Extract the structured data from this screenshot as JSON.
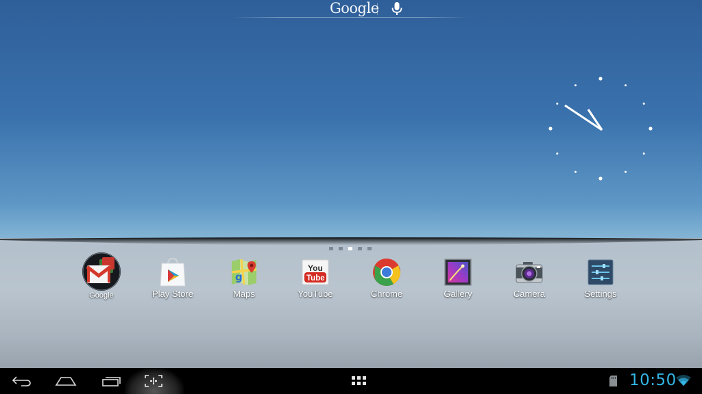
{
  "search_bar": {
    "logo_text": "Google",
    "voice_icon": "mic-icon"
  },
  "clock_widget": {
    "type": "analog",
    "hour_icon": "clock-hands-icon"
  },
  "home_pages": {
    "count": 5,
    "active_index": 2
  },
  "dock": {
    "apps": [
      {
        "label": "Google",
        "icon": "google-folder-icon"
      },
      {
        "label": "Play Store",
        "icon": "play-store-icon"
      },
      {
        "label": "Maps",
        "icon": "maps-icon"
      },
      {
        "label": "YouTube",
        "icon": "youtube-icon"
      },
      {
        "label": "Chrome",
        "icon": "chrome-icon"
      },
      {
        "label": "Gallery",
        "icon": "gallery-icon"
      },
      {
        "label": "Camera",
        "icon": "camera-icon"
      },
      {
        "label": "Settings",
        "icon": "settings-icon"
      }
    ]
  },
  "nav_bar": {
    "buttons": [
      "back-icon",
      "home-icon",
      "recent-apps-icon",
      "screenshot-icon",
      "app-drawer-icon"
    ],
    "status": {
      "time": "10:50",
      "sd_icon": "sd-card-icon",
      "wifi_icon": "wifi-icon"
    }
  },
  "colors": {
    "accent": "#33b5e5",
    "wallpaper_top": "#2f5f99",
    "wallpaper_bottom": "#a9cbe0",
    "navbar": "#000000"
  }
}
